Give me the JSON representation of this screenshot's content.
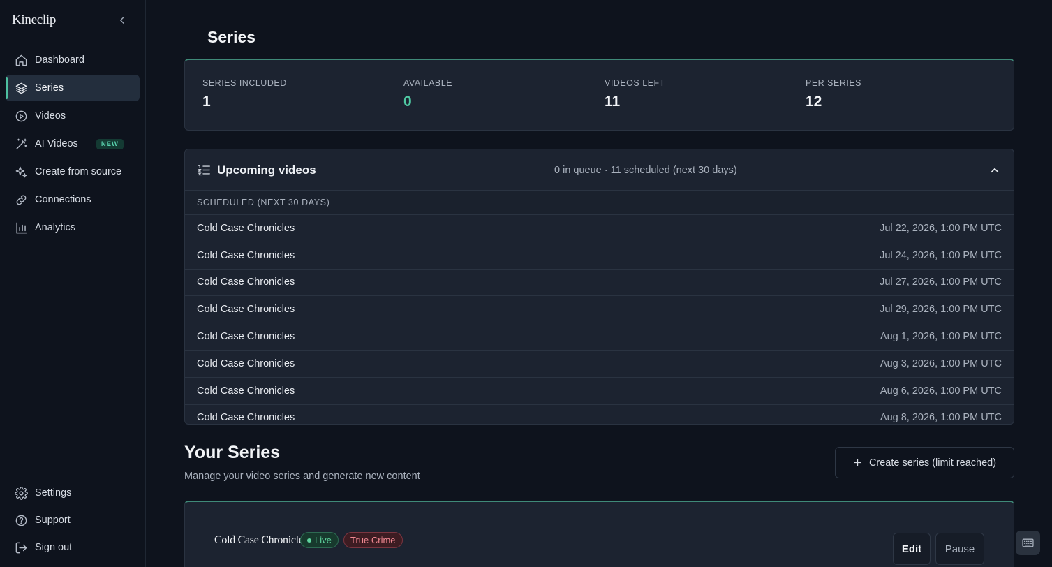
{
  "app": {
    "brand": "Kineclip"
  },
  "sidebar": {
    "items": [
      {
        "label": "Dashboard",
        "icon": "home-icon"
      },
      {
        "label": "Series",
        "icon": "layers-icon",
        "active": true
      },
      {
        "label": "Videos",
        "icon": "play-circle-icon"
      },
      {
        "label": "AI Videos",
        "icon": "magic-wand-icon",
        "badge": "NEW"
      },
      {
        "label": "Create from source",
        "icon": "sparkles-icon"
      },
      {
        "label": "Connections",
        "icon": "link-icon"
      },
      {
        "label": "Analytics",
        "icon": "bar-chart-icon"
      }
    ],
    "bottom": [
      {
        "label": "Settings",
        "icon": "gear-icon"
      },
      {
        "label": "Support",
        "icon": "help-circle-icon"
      },
      {
        "label": "Sign out",
        "icon": "sign-out-icon"
      }
    ]
  },
  "page": {
    "title": "Series"
  },
  "stats": [
    {
      "label": "SERIES INCLUDED",
      "value": "1"
    },
    {
      "label": "AVAILABLE",
      "value": "0"
    },
    {
      "label": "VIDEOS LEFT",
      "value": "11"
    },
    {
      "label": "PER SERIES",
      "value": "12"
    }
  ],
  "upcoming": {
    "title": "Upcoming videos",
    "summary": "0 in queue · 11 scheduled (next 30 days)",
    "section_label": "SCHEDULED (NEXT 30 DAYS)",
    "rows": [
      {
        "name": "Cold Case Chronicles",
        "date": "Jul 22, 2026, 1:00 PM UTC"
      },
      {
        "name": "Cold Case Chronicles",
        "date": "Jul 24, 2026, 1:00 PM UTC"
      },
      {
        "name": "Cold Case Chronicles",
        "date": "Jul 27, 2026, 1:00 PM UTC"
      },
      {
        "name": "Cold Case Chronicles",
        "date": "Jul 29, 2026, 1:00 PM UTC"
      },
      {
        "name": "Cold Case Chronicles",
        "date": "Aug 1, 2026, 1:00 PM UTC"
      },
      {
        "name": "Cold Case Chronicles",
        "date": "Aug 3, 2026, 1:00 PM UTC"
      },
      {
        "name": "Cold Case Chronicles",
        "date": "Aug 6, 2026, 1:00 PM UTC"
      },
      {
        "name": "Cold Case Chronicles",
        "date": "Aug 8, 2026, 1:00 PM UTC"
      }
    ]
  },
  "your_series": {
    "title": "Your Series",
    "subtitle": "Manage your video series and generate new content",
    "create_label": "Create series (limit reached)"
  },
  "series_card": {
    "name": "Cold Case Chronicles",
    "status": "Live",
    "genre": "True Crime",
    "edit_label": "Edit",
    "pause_label": "Pause"
  },
  "colors": {
    "accent": "#4fc8a2",
    "background": "#0e131d",
    "card": "#1c2330"
  }
}
